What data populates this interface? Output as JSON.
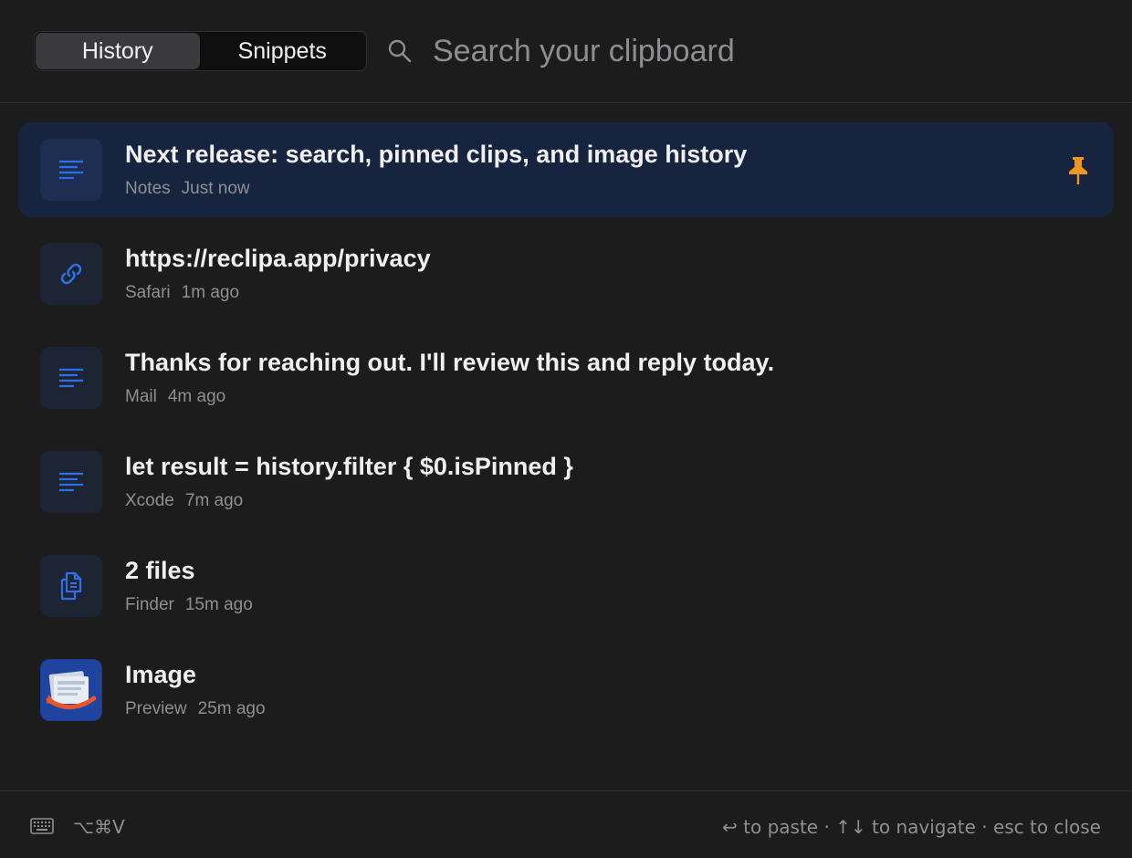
{
  "header": {
    "tabs": [
      {
        "label": "History",
        "active": true
      },
      {
        "label": "Snippets",
        "active": false
      }
    ],
    "search": {
      "placeholder": "Search your clipboard",
      "value": ""
    }
  },
  "items": [
    {
      "title": "Next release: search, pinned clips, and image history",
      "app": "Notes",
      "time": "Just now",
      "icon": "text-lines-icon",
      "selected": true,
      "pinned": true
    },
    {
      "title": "https://reclipa.app/privacy",
      "app": "Safari",
      "time": "1m ago",
      "icon": "link-icon",
      "selected": false,
      "pinned": false
    },
    {
      "title": "Thanks for reaching out. I'll review this and reply today.",
      "app": "Mail",
      "time": "4m ago",
      "icon": "text-lines-icon",
      "selected": false,
      "pinned": false
    },
    {
      "title": "let result = history.filter { $0.isPinned }",
      "app": "Xcode",
      "time": "7m ago",
      "icon": "text-lines-icon",
      "selected": false,
      "pinned": false
    },
    {
      "title": "2 files",
      "app": "Finder",
      "time": "15m ago",
      "icon": "documents-icon",
      "selected": false,
      "pinned": false
    },
    {
      "title": "Image",
      "app": "Preview",
      "time": "25m ago",
      "icon": "preview-app-icon",
      "selected": false,
      "pinned": false
    }
  ],
  "footer": {
    "shortcut": "⌥⌘V",
    "hints": "↩ to paste · ↑↓ to navigate · esc to close"
  },
  "colors": {
    "accent": "#2f6fe6",
    "pin": "#f0961e",
    "selected_row": "#172440"
  }
}
